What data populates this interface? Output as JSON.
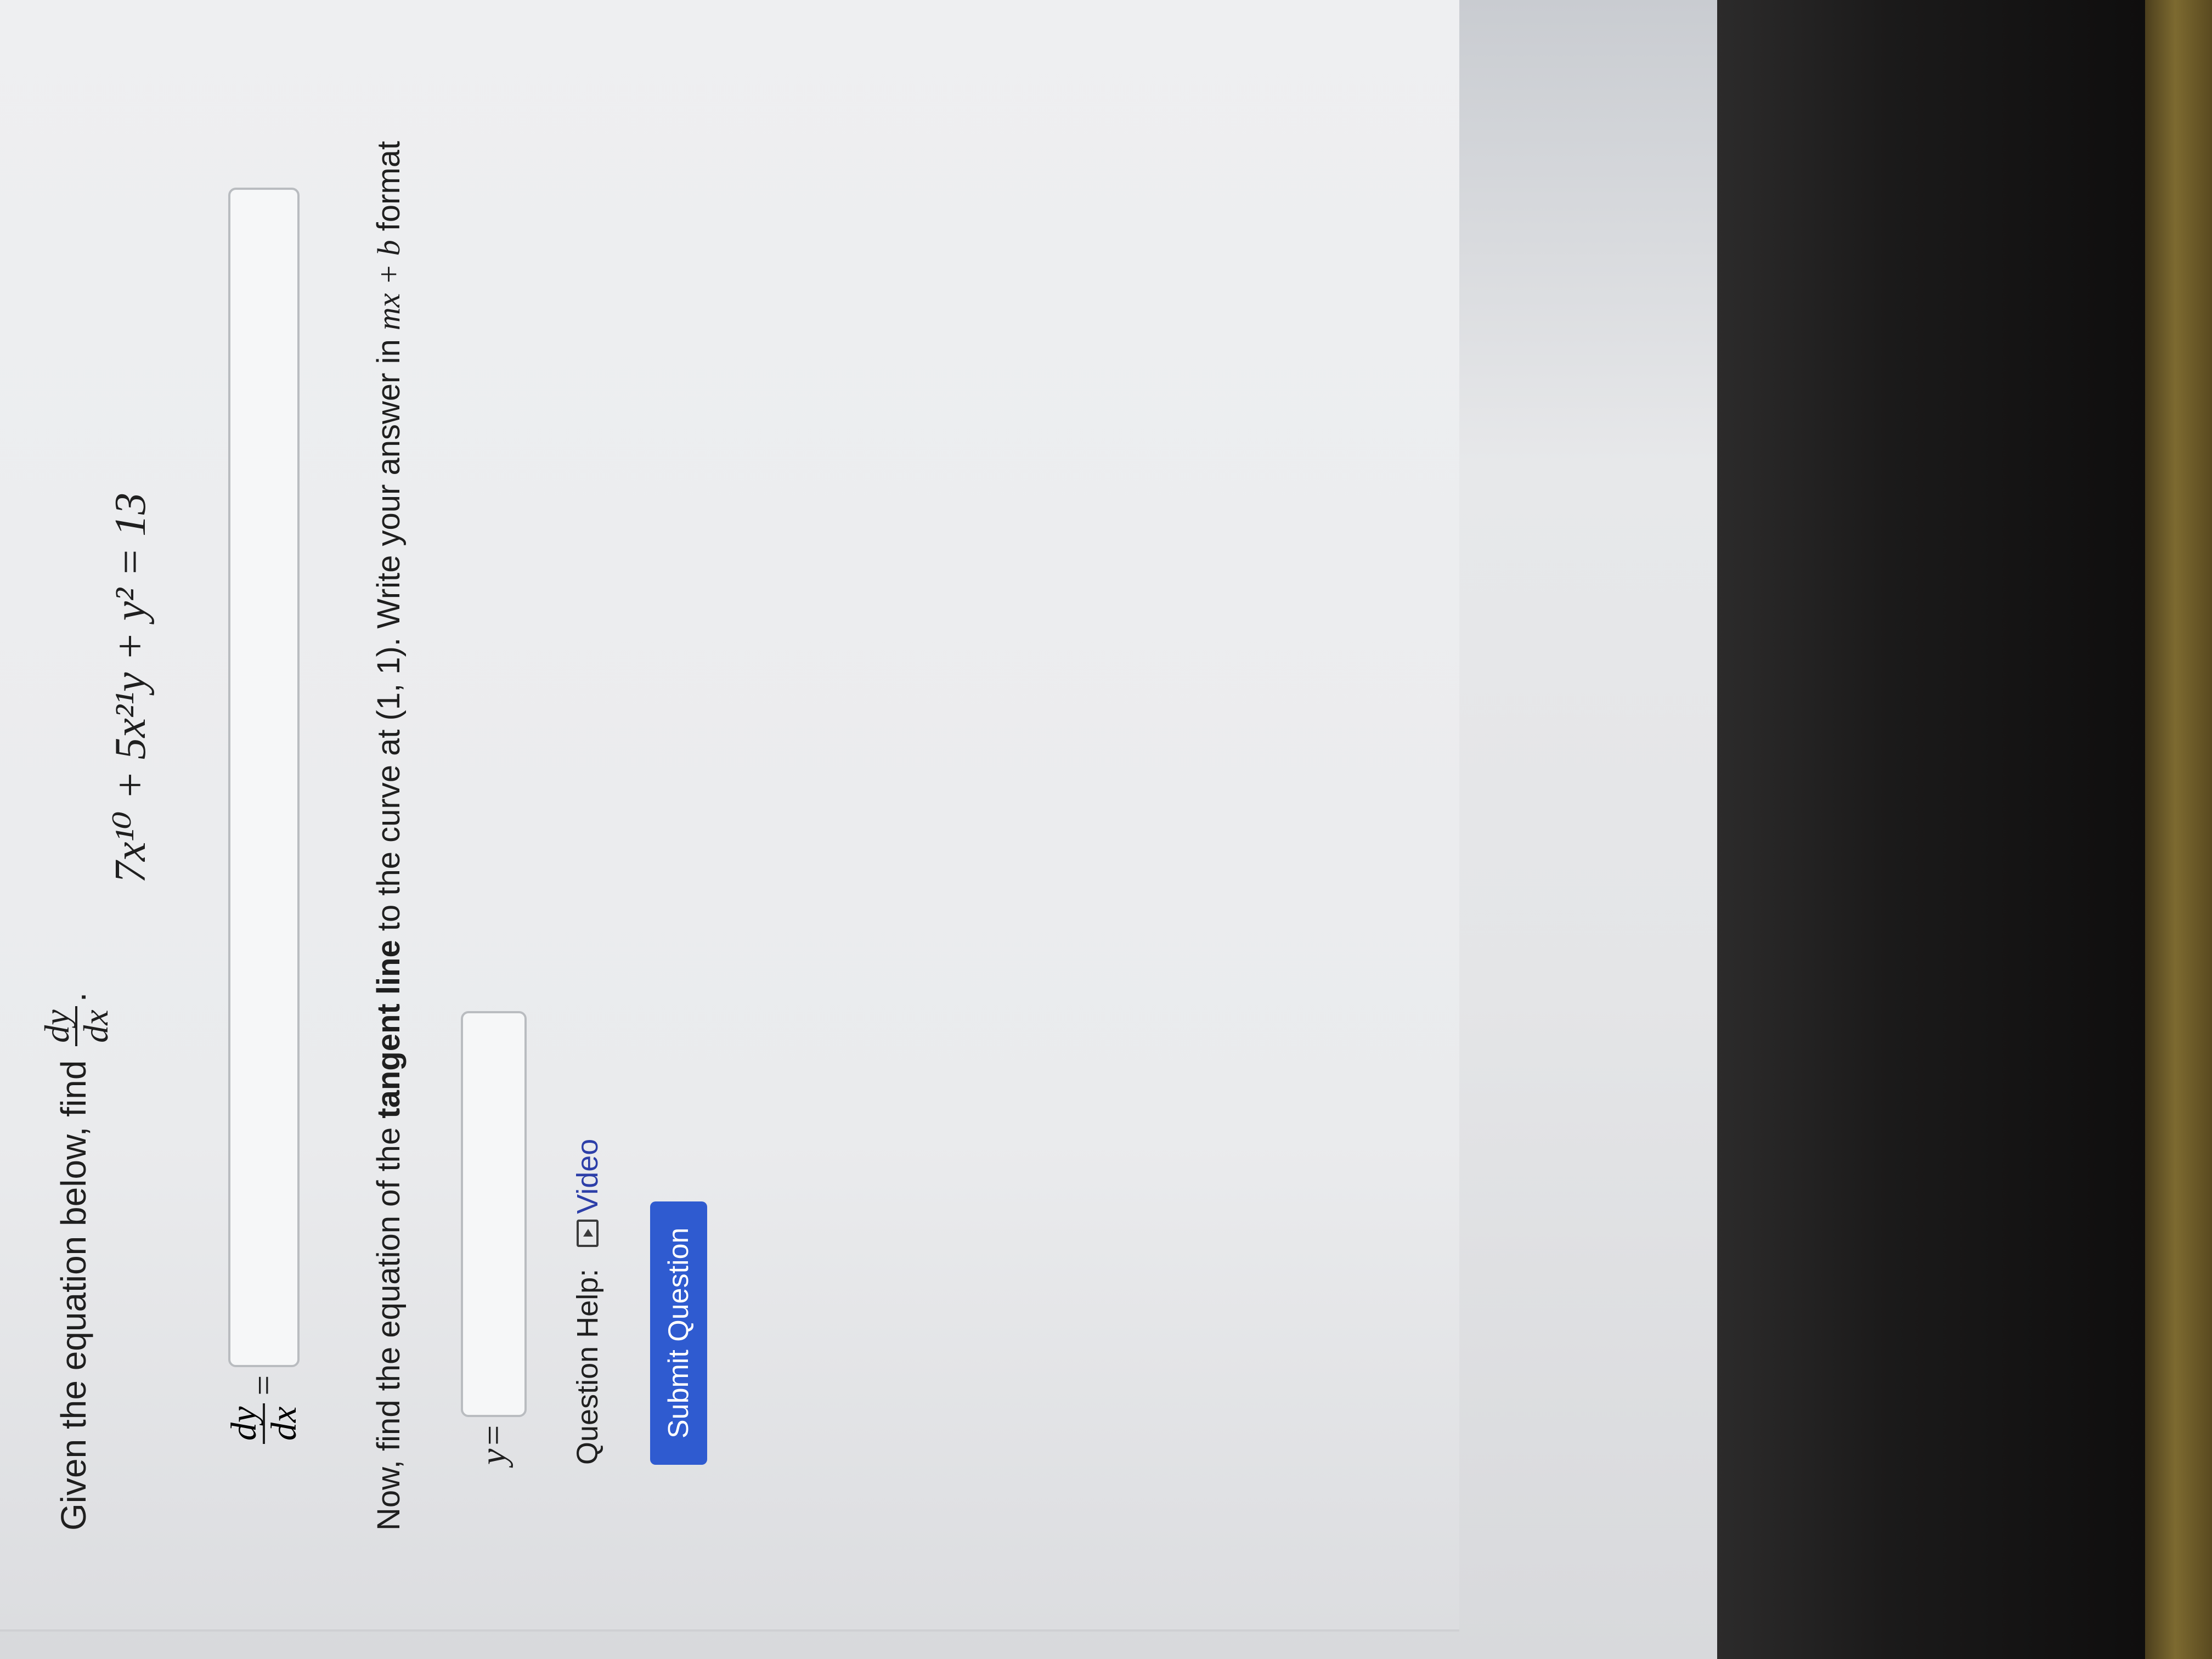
{
  "question": {
    "prompt_text": "Given the equation below, find",
    "find_fraction": {
      "numerator": "dy",
      "denominator": "dx"
    },
    "prompt_end": ".",
    "equation": "7x¹⁰ + 5x²¹y + y² = 13"
  },
  "part1": {
    "label_fraction": {
      "numerator": "dy",
      "denominator": "dx"
    },
    "equals": "=",
    "input_value": ""
  },
  "part2": {
    "text_before": "Now, find the equation of the ",
    "text_bold": "tangent line",
    "text_middle": " to the curve at (1, 1). Write your answer in ",
    "format_math": "mx + b",
    "text_after": " format",
    "label": "y",
    "equals": "=",
    "input_value": ""
  },
  "help": {
    "label": "Question Help:",
    "video_label": "Video",
    "video_icon": "play-video-icon"
  },
  "submit": {
    "label": "Submit Question",
    "color": "#2f5bd0"
  }
}
